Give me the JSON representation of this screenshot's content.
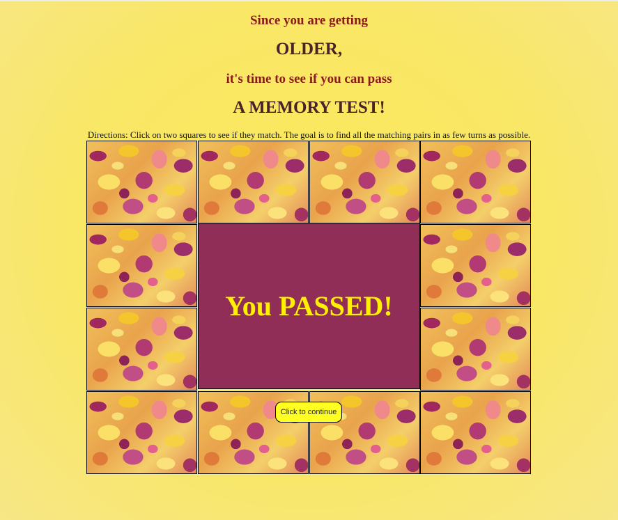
{
  "header": {
    "line1": "Since you are getting",
    "line2": "OLDER,",
    "line3": "it's time to see if you can pass",
    "line4": "A MEMORY TEST!"
  },
  "directions": "Directions: Click on two squares to see if they match. The goal is to find all the matching pairs in as few turns as possible.",
  "result": {
    "message": "You PASSED!",
    "panel_color": "#912e58",
    "text_color": "#ffef00"
  },
  "continue_button": {
    "label": "Click to continue",
    "color": "#ffff22"
  },
  "board": {
    "rows": 4,
    "cols": 4,
    "face_down_tile": "autumn-leaves-image"
  }
}
